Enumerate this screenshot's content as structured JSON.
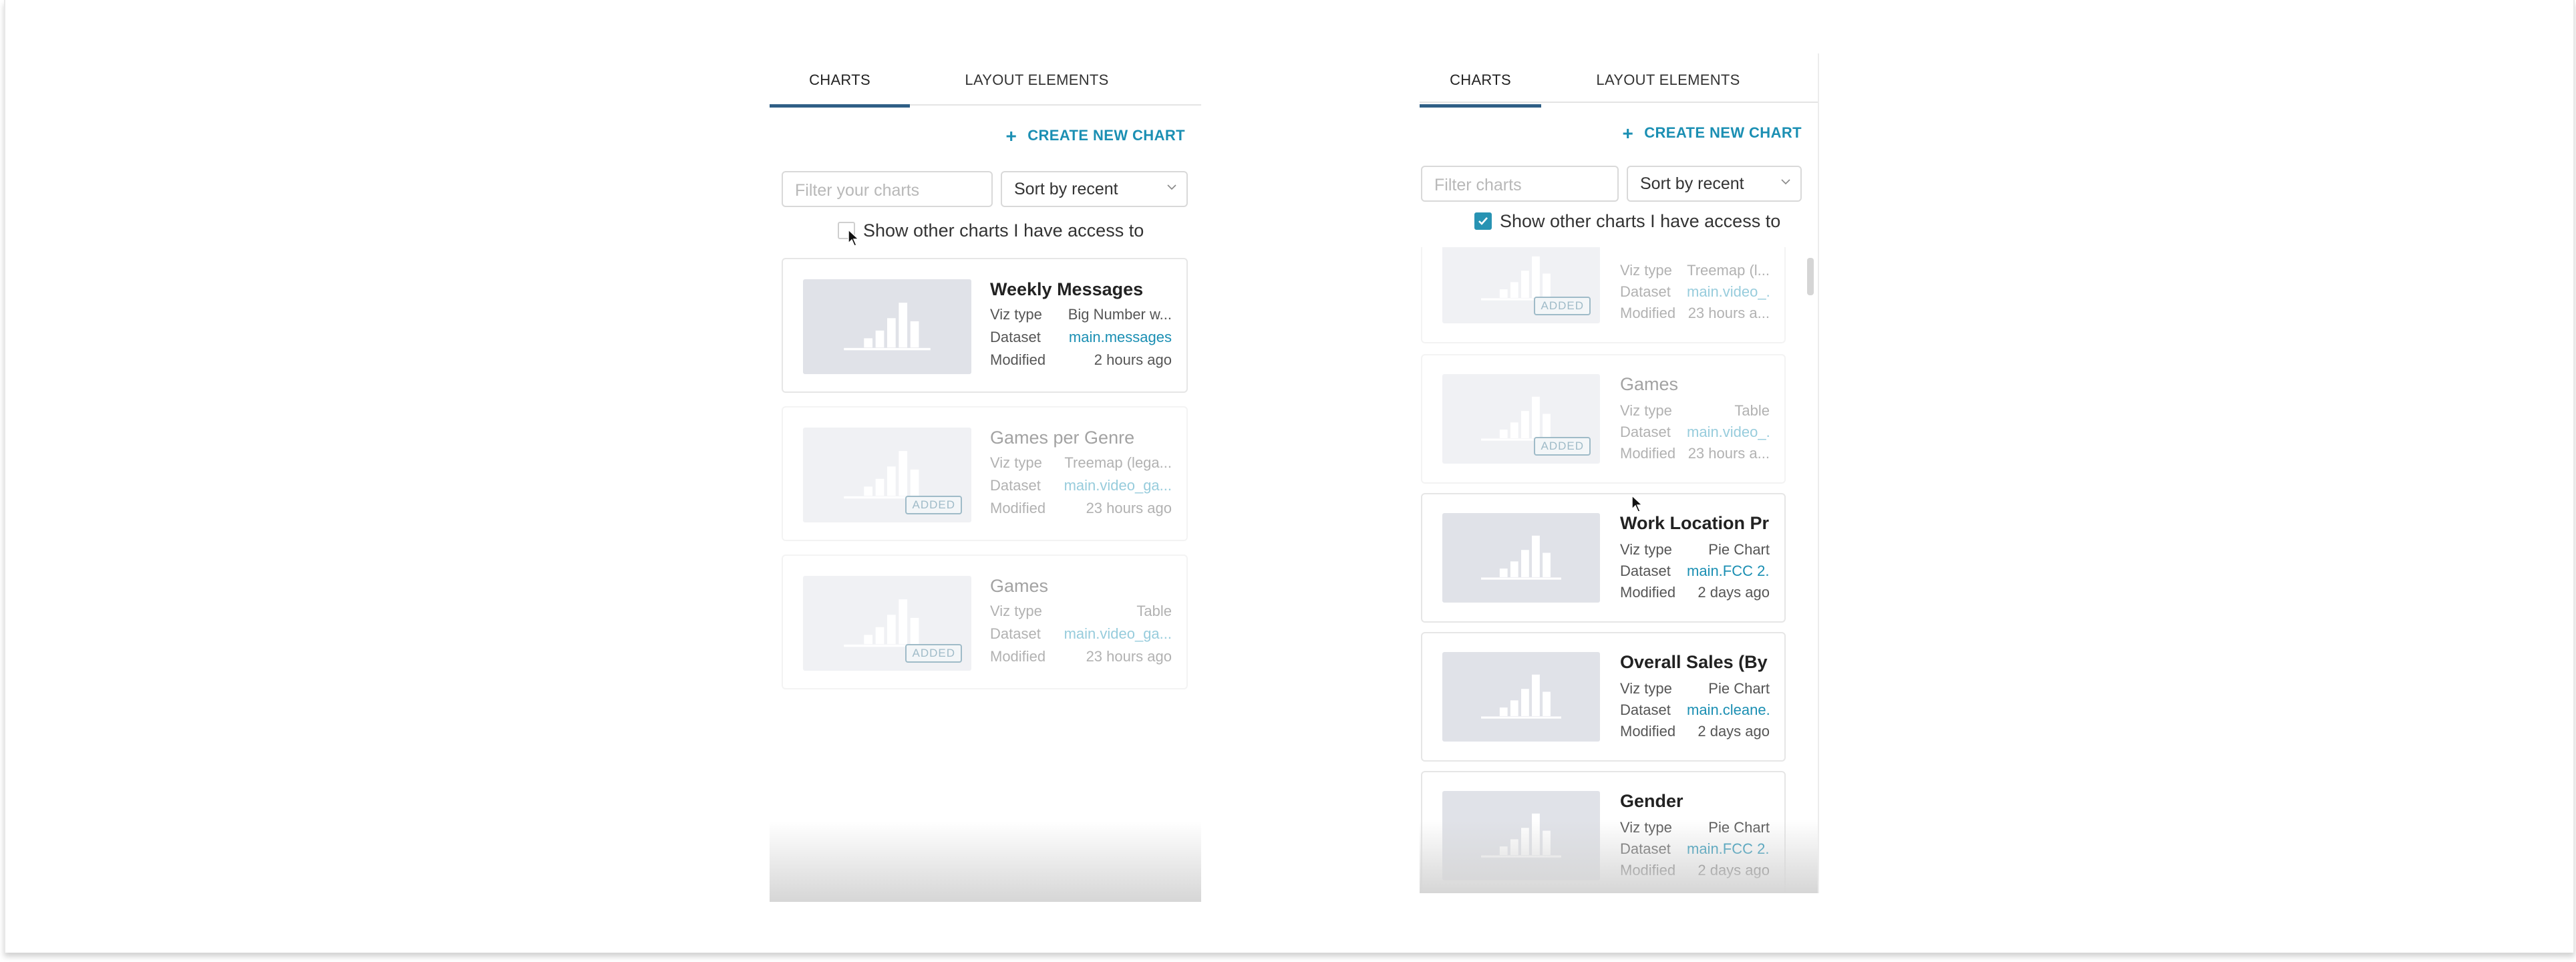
{
  "left": {
    "tabs": [
      "CHARTS",
      "LAYOUT ELEMENTS"
    ],
    "create_label": "CREATE NEW CHART",
    "filter_placeholder": "Filter your charts",
    "sort_value": "Sort by recent",
    "show_other_label": "Show other charts I have access to",
    "show_other_checked": false,
    "meta_labels": {
      "viz": "Viz type",
      "dataset": "Dataset",
      "modified": "Modified"
    },
    "badge": "ADDED",
    "cards": [
      {
        "title": "Weekly Messages",
        "viz": "Big Number w...",
        "dataset": "main.messages",
        "modified": "2 hours ago",
        "added": false
      },
      {
        "title": "Games per Genre",
        "viz": "Treemap (lega...",
        "dataset": "main.video_ga...",
        "modified": "23 hours ago",
        "added": true
      },
      {
        "title": "Games",
        "viz": "Table",
        "dataset": "main.video_ga...",
        "modified": "23 hours ago",
        "added": true
      }
    ]
  },
  "right": {
    "tabs": [
      "CHARTS",
      "LAYOUT ELEMENTS"
    ],
    "create_label": "CREATE NEW CHART",
    "filter_placeholder": "Filter charts",
    "sort_value": "Sort by recent",
    "show_other_label": "Show other charts I have access to",
    "show_other_checked": true,
    "meta_labels": {
      "viz": "Viz type",
      "dataset": "Dataset",
      "modified": "Modified"
    },
    "badge": "ADDED",
    "cards": [
      {
        "title": "",
        "viz": "Treemap (l...",
        "dataset": "main.video_...",
        "modified": "23 hours a...",
        "added": true
      },
      {
        "title": "Games",
        "viz": "Table",
        "dataset": "main.video_...",
        "modified": "23 hours a...",
        "added": true
      },
      {
        "title": "Work Location Pre...",
        "viz": "Pie Chart",
        "dataset": "main.FCC 2...",
        "modified": "2 days ago",
        "added": false
      },
      {
        "title": "Overall Sales (By P...",
        "viz": "Pie Chart",
        "dataset": "main.cleane...",
        "modified": "2 days ago",
        "added": false
      },
      {
        "title": "Gender",
        "viz": "Pie Chart",
        "dataset": "main.FCC 2...",
        "modified": "2 days ago",
        "added": false
      }
    ]
  },
  "colors": {
    "accent": "#1b8fb3",
    "tab_underline": "#2f5f86",
    "thumb_bg": "#e0e2e8",
    "badge": "#2d6a86"
  },
  "icons": {
    "plus": "plus-icon",
    "chevron": "chevron-down-icon",
    "check": "check-icon",
    "thumbnail": "bar-chart-thumbnail-icon"
  }
}
